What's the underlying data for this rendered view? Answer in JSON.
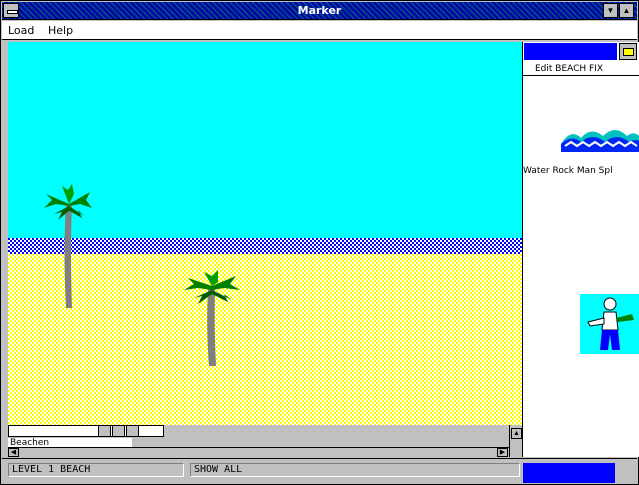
{
  "window": {
    "title": "Marker"
  },
  "menu": {
    "items": [
      "Load",
      "Help"
    ]
  },
  "panel": {
    "tabs_text": "Edit  BEACH FIX",
    "categories_text": "Water Rock Man Spl"
  },
  "scene_status": {
    "small_label": "Beachen"
  },
  "statusbar": {
    "field1": "LEVEL 1  BEACH",
    "field2": "SHOW ALL"
  },
  "colors": {
    "sky": "#00ffff",
    "water": "#0000ff",
    "sand": "#ffff00",
    "title_bar": "#0000a8",
    "panel_header": "#0000ff"
  },
  "icons": [
    "system-menu-icon",
    "minimize-icon",
    "maximize-icon",
    "palm-tree-icon",
    "folder-icon",
    "wave-thumbnail-icon",
    "man-thumbnail-icon"
  ]
}
